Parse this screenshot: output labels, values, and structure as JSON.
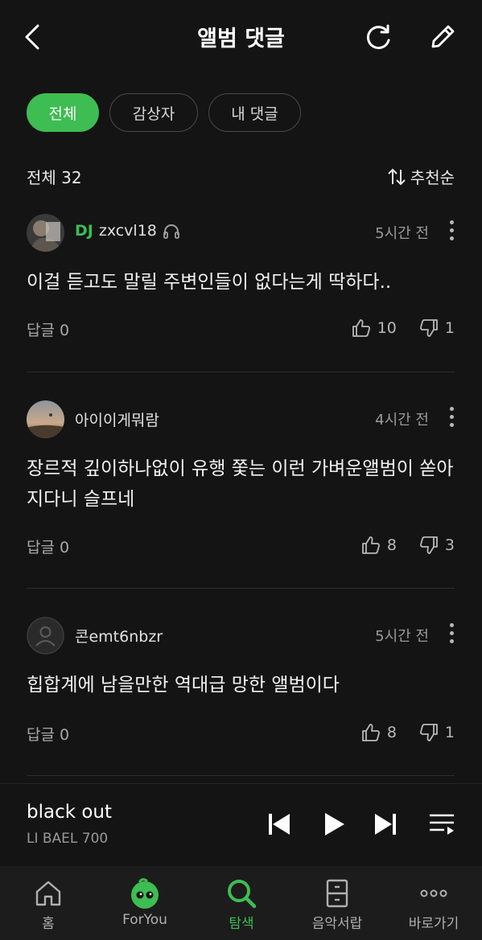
{
  "header": {
    "title": "앨범 댓글",
    "back_icon": "chevron-left-icon",
    "refresh_icon": "refresh-icon",
    "edit_icon": "pencil-icon"
  },
  "filters": [
    {
      "label": "전체",
      "active": true
    },
    {
      "label": "감상자",
      "active": false
    },
    {
      "label": "내 댓글",
      "active": false
    }
  ],
  "summary": {
    "count_label": "전체 32",
    "sort_label": "추천순"
  },
  "comments": [
    {
      "dj_badge": "DJ",
      "username": "zxcvl18",
      "time": "5시간 전",
      "text": "이걸 듣고도 말릴 주변인들이 없다는게 딱하다..",
      "reply": "답글 0",
      "likes": "10",
      "dislikes": "1"
    },
    {
      "username": "아이이게뭐람",
      "time": "4시간 전",
      "text": "장르적 깊이하나없이 유행 쫓는 이런 가벼운앨범이 쏟아지다니 슬프네",
      "reply": "답글 0",
      "likes": "8",
      "dislikes": "3"
    },
    {
      "username": "콘emt6nbzr",
      "time": "5시간 전",
      "text": "힙합계에 남을만한 역대급 망한 앨범이다",
      "reply": "답글 0",
      "likes": "8",
      "dislikes": "1"
    }
  ],
  "player": {
    "song": "black out",
    "artist": "LI BAEL 700"
  },
  "nav": [
    {
      "label": "홈",
      "icon": "home-icon",
      "active": false
    },
    {
      "label": "ForYou",
      "icon": "foryou-mascot-icon",
      "active": false
    },
    {
      "label": "탐색",
      "icon": "search-icon",
      "active": true
    },
    {
      "label": "음악서랍",
      "icon": "drawer-icon",
      "active": false
    },
    {
      "label": "바로가기",
      "icon": "more-icon",
      "active": false
    }
  ],
  "colors": {
    "accent": "#3dbd52",
    "background": "#141414",
    "nav_background": "#1c1c1c"
  }
}
